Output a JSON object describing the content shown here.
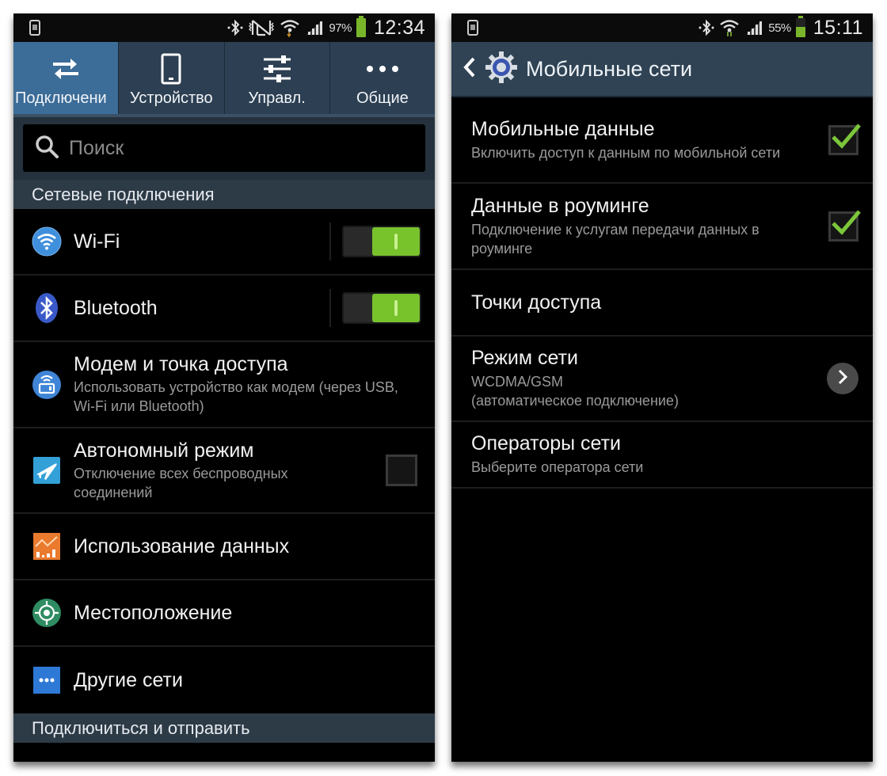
{
  "left_screen": {
    "status_bar": {
      "battery_percent": "97%",
      "battery_level": 0.97,
      "time": "12:34",
      "icons": [
        "watch-icon",
        "bluetooth-icon",
        "mute-vibrate-icon",
        "wifi-icon",
        "signal-icon",
        "battery-icon"
      ]
    },
    "tabs": [
      {
        "label": "Подключени",
        "icon": "swap-arrows-icon",
        "active": true
      },
      {
        "label": "Устройство",
        "icon": "phone-icon",
        "active": false
      },
      {
        "label": "Управл.",
        "icon": "sliders-icon",
        "active": false
      },
      {
        "label": "Общие",
        "icon": "more-dots-icon",
        "active": false
      }
    ],
    "search": {
      "placeholder": "Поиск",
      "value": ""
    },
    "section_network": "Сетевые подключения",
    "items": [
      {
        "title": "Wi-Fi",
        "subtitle": "",
        "icon": "wifi-icon",
        "control": "toggle",
        "state": true
      },
      {
        "title": "Bluetooth",
        "subtitle": "",
        "icon": "bluetooth-icon",
        "control": "toggle",
        "state": true
      },
      {
        "title": "Модем и точка доступа",
        "subtitle": "Использовать устройство как модем (через USB, Wi-Fi или Bluetooth)",
        "icon": "hotspot-icon",
        "control": "none"
      },
      {
        "title": "Автономный режим",
        "subtitle": "Отключение всех беспроводных соединений",
        "icon": "airplane-icon",
        "control": "checkbox",
        "state": false
      },
      {
        "title": "Использование данных",
        "subtitle": "",
        "icon": "data-usage-icon",
        "control": "none"
      },
      {
        "title": "Местоположение",
        "subtitle": "",
        "icon": "location-icon",
        "control": "none"
      },
      {
        "title": "Другие сети",
        "subtitle": "",
        "icon": "more-networks-icon",
        "control": "none"
      }
    ],
    "section_connect": "Подключиться и отправить"
  },
  "right_screen": {
    "status_bar": {
      "battery_percent": "55%",
      "battery_level": 0.55,
      "time": "15:11",
      "icons": [
        "watch-icon",
        "bluetooth-icon",
        "wifi-icon",
        "signal-icon",
        "battery-icon"
      ]
    },
    "title": "Мобильные сети",
    "items": [
      {
        "title": "Мобильные данные",
        "subtitle": "Включить доступ к данным по мобильной сети",
        "control": "checkbox",
        "state": true
      },
      {
        "title": "Данные в роуминге",
        "subtitle": "Подключение к услугам передачи данных в роуминге",
        "control": "checkbox",
        "state": true
      },
      {
        "title": "Точки доступа",
        "subtitle": "",
        "control": "none"
      },
      {
        "title": "Режим сети",
        "subtitle": "WCDMA/GSM",
        "subtitle2": "(автоматическое подключение)",
        "control": "chevron"
      },
      {
        "title": "Операторы сети",
        "subtitle": "Выберите оператора сети",
        "control": "none"
      }
    ]
  },
  "colors": {
    "toggle_on": "#78c22c",
    "check_green": "#7cc63a",
    "tab_active": "#3c6c98",
    "tab_bar": "#2d3f52",
    "section_header": "#2d3b47",
    "title_bar": "#2f4354"
  }
}
